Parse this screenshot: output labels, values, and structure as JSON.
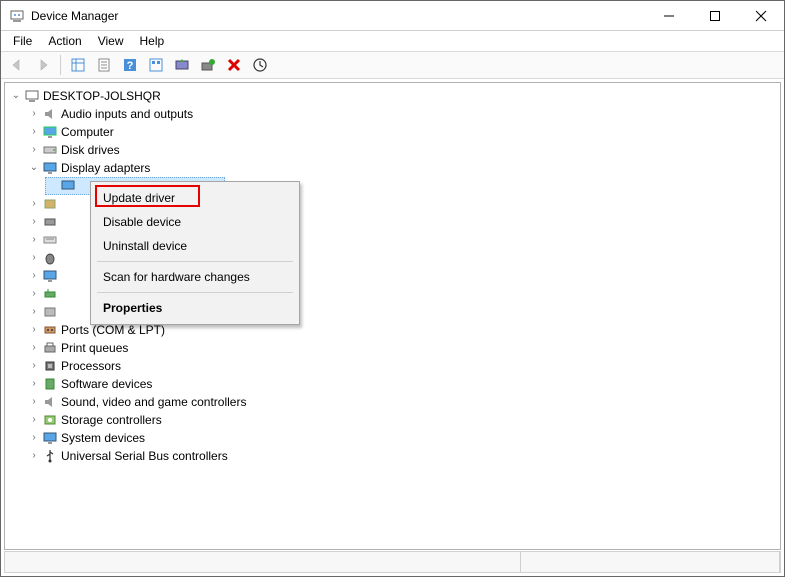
{
  "window": {
    "title": "Device Manager"
  },
  "menu": {
    "file": "File",
    "action": "Action",
    "view": "View",
    "help": "Help"
  },
  "tree": {
    "root": "DESKTOP-JOLSHQR",
    "items": [
      "Audio inputs and outputs",
      "Computer",
      "Disk drives",
      "Display adapters",
      "",
      "",
      "",
      "",
      "",
      "",
      "",
      "",
      "Ports (COM & LPT)",
      "Print queues",
      "Processors",
      "Software devices",
      "Sound, video and game controllers",
      "Storage controllers",
      "System devices",
      "Universal Serial Bus controllers"
    ]
  },
  "context_menu": {
    "update": "Update driver",
    "disable": "Disable device",
    "uninstall": "Uninstall device",
    "scan": "Scan for hardware changes",
    "properties": "Properties"
  }
}
